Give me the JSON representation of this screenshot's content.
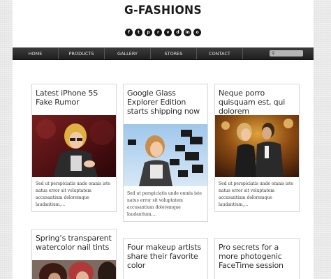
{
  "site": {
    "title": "G-FASHIONS"
  },
  "social": [
    {
      "icon": "facebook-icon",
      "glyph": "f"
    },
    {
      "icon": "twitter-icon",
      "glyph": "t"
    },
    {
      "icon": "pinterest-icon",
      "glyph": "p"
    },
    {
      "icon": "rss-icon",
      "glyph": "r"
    },
    {
      "icon": "vimeo-icon",
      "glyph": "v"
    },
    {
      "icon": "dribbble-icon",
      "glyph": "d"
    },
    {
      "icon": "linkedin-icon",
      "glyph": "in"
    },
    {
      "icon": "instagram-icon",
      "glyph": "o"
    }
  ],
  "nav": {
    "items": [
      "HOME",
      "PRODUCTS",
      "GALLERY",
      "STORES",
      "CONTACT"
    ],
    "search_icon": "search-icon"
  },
  "posts": [
    {
      "title": "Latest iPhone 5S Fake Rumor",
      "excerpt": "Sed ut perspiciatis unde omnis iste natus error sit voluptatem accusantium doloremque laudantium,..."
    },
    {
      "title": "Google Glass Explorer Edition starts shipping now",
      "excerpt": "Sed ut perspiciatis unde omnis iste natus error sit voluptatem accusantium doloremque laudantium,..."
    },
    {
      "title": "Neque porro quisquam est, qui dolorem",
      "excerpt": "Sed ut perspiciatis unde omnis iste natus error sit voluptatem accusantium doloremque laudantium,..."
    },
    {
      "title": "Spring’s transparent watercolor nail tints",
      "excerpt": ""
    },
    {
      "title": "Four makeup artists share their favorite color",
      "excerpt": ""
    },
    {
      "title": "Pro secrets for a more photogenic FaceTime session",
      "excerpt": ""
    }
  ],
  "colors": {
    "background": "#e9e9e9",
    "page": "#ffffff",
    "navbar": "#2a2a2a",
    "text": "#2b2b2b"
  }
}
